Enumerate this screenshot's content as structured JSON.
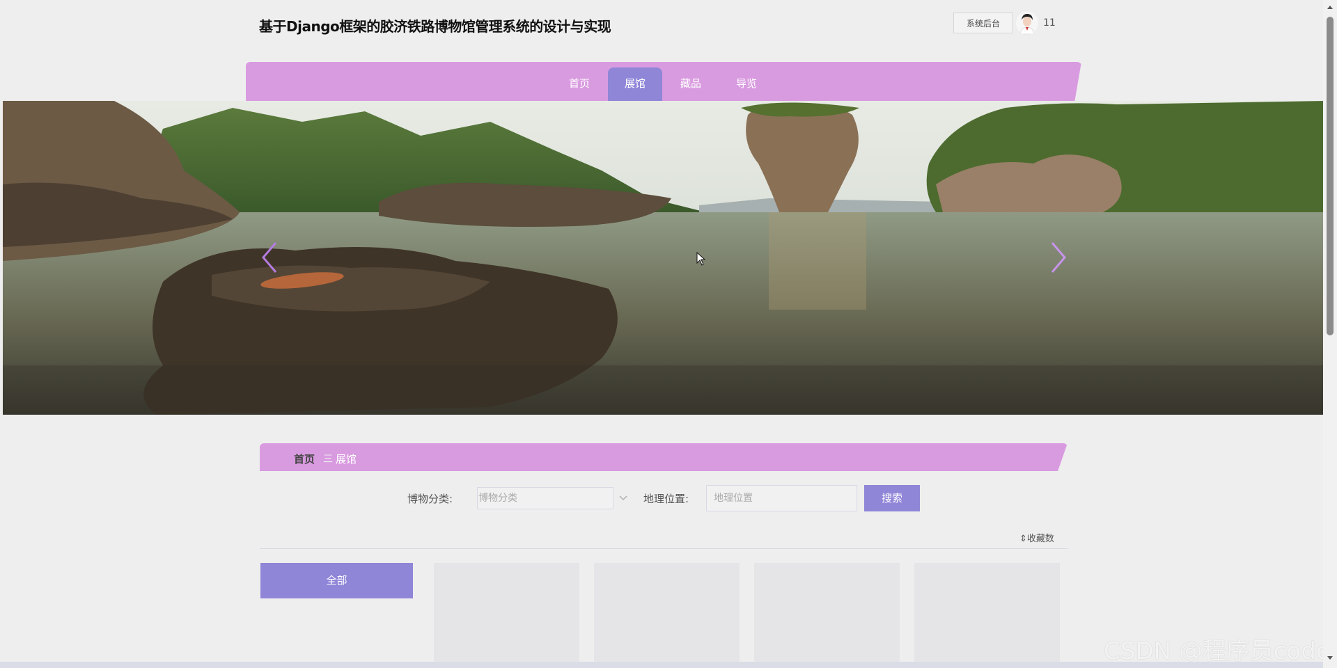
{
  "header": {
    "title": "基于Django框架的胶济铁路博物馆管理系统的设计与实现",
    "admin_label": "系统后台",
    "username": "11"
  },
  "nav": {
    "items": [
      "首页",
      "展馆",
      "藏品",
      "导览"
    ],
    "active": "展馆"
  },
  "breadcrumb": {
    "home": "首页",
    "separator": "三",
    "current": "展馆"
  },
  "filters": {
    "category_label": "博物分类:",
    "category_placeholder": "博物分类",
    "location_label": "地理位置:",
    "location_placeholder": "地理位置",
    "search_label": "搜索"
  },
  "sort": {
    "label": "收藏数"
  },
  "categories": {
    "all_label": "全部"
  },
  "watermark": "CSDN @程序员code",
  "colors": {
    "nav_bg": "#d99be0",
    "accent": "#8f86d8",
    "page_bg": "#eeeeee"
  }
}
